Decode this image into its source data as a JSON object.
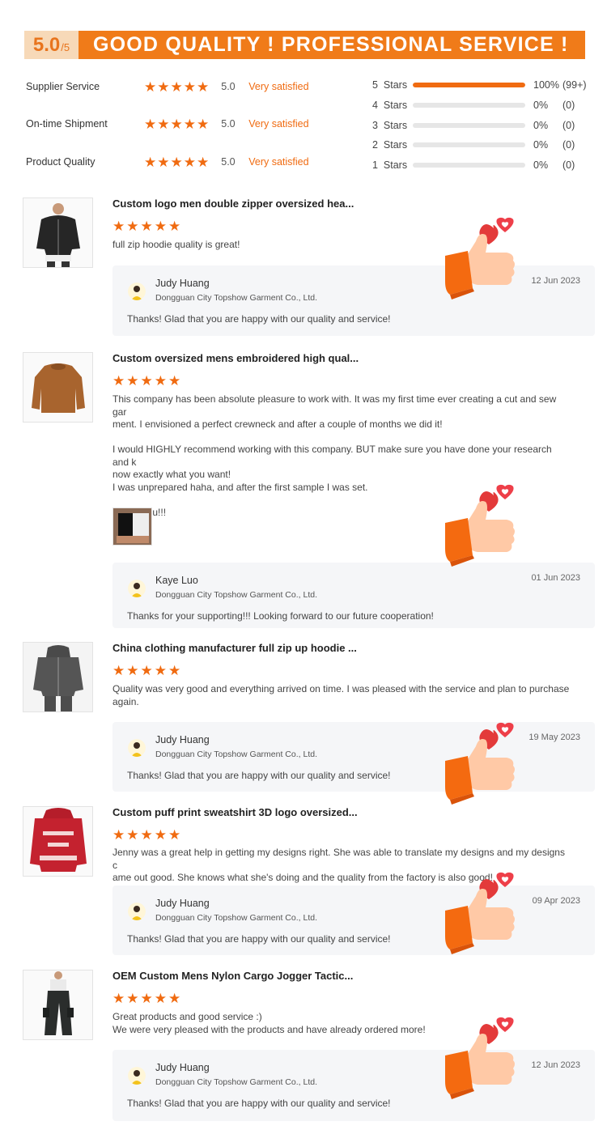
{
  "header": {
    "score": "5.0",
    "score_of": "/5",
    "slogan": "GOOD QUALITY ! PROFESSIONAL SERVICE !"
  },
  "ratings": [
    {
      "label": "Supplier Service",
      "stars": 5,
      "value": "5.0",
      "text": "Very satisfied"
    },
    {
      "label": "On-time Shipment",
      "stars": 5,
      "value": "5.0",
      "text": "Very satisfied"
    },
    {
      "label": "Product Quality",
      "stars": 5,
      "value": "5.0",
      "text": "Very satisfied"
    }
  ],
  "distribution": [
    {
      "label": "5  Stars",
      "fraction": 1.0,
      "pct": "100%",
      "count": "(99+)"
    },
    {
      "label": "4  Stars",
      "fraction": 0,
      "pct": "0%",
      "count": "(0)"
    },
    {
      "label": "3  Stars",
      "fraction": 0,
      "pct": "0%",
      "count": "(0)"
    },
    {
      "label": "2  Stars",
      "fraction": 0,
      "pct": "0%",
      "count": "(0)"
    },
    {
      "label": "1  Stars",
      "fraction": 0,
      "pct": "0%",
      "count": "(0)"
    }
  ],
  "reviews": [
    {
      "title": "Custom logo men double zipper oversized hea...",
      "stars": 5,
      "body": "full zip hoodie quality is great!",
      "reply": {
        "name": "Judy Huang",
        "company": "Dongguan City Topshow Garment Co., Ltd.",
        "date": "12 Jun 2023",
        "msg": "Thanks!  Glad that you are happy with our quality and service!"
      }
    },
    {
      "title": "Custom oversized mens embroidered high qual...",
      "stars": 5,
      "body": "This company has been absolute pleasure to work with. It was my first time ever creating a cut and sew gar\nment. I envisioned a perfect crewneck and after a couple of months we did it!\n\nI would HIGHLY recommend working with this company. BUT make sure you have done your research and k\nnow exactly what you want!\nI was unprepared haha, and after the first sample I was set.\n\nThank you!!!",
      "reply": {
        "name": "Kaye Luo",
        "company": "Dongguan City Topshow Garment Co., Ltd.",
        "date": "01 Jun 2023",
        "msg": "Thanks for your supporting!!! Looking forward to our future cooperation!"
      }
    },
    {
      "title": "China clothing manufacturer full zip up hoodie ...",
      "stars": 5,
      "body": "Quality was very good and everything arrived on time. I was pleased with the service and plan to purchase\nagain.",
      "reply": {
        "name": "Judy Huang",
        "company": "Dongguan City Topshow Garment Co., Ltd.",
        "date": "19 May 2023",
        "msg": "Thanks!  Glad that you are happy with our quality and service!"
      }
    },
    {
      "title": "Custom puff print sweatshirt 3D logo oversized...",
      "stars": 5,
      "body": "Jenny was a great help in getting my designs right. She was able to translate my designs and my designs c\name out good. She knows what she's doing and the quality from the factory is also good!",
      "reply": {
        "name": "Judy Huang",
        "company": "Dongguan City Topshow Garment Co., Ltd.",
        "date": "09 Apr 2023",
        "msg": "Thanks!  Glad that you are happy with our quality and service!"
      }
    },
    {
      "title": "OEM Custom Mens Nylon Cargo Jogger Tactic...",
      "stars": 5,
      "body": "Great products and good service :)\nWe were very pleased with the products and have already ordered more!",
      "reply": {
        "name": "Judy Huang",
        "company": "Dongguan City Topshow Garment Co., Ltd.",
        "date": "12 Jun 2023",
        "msg": "Thanks!  Glad that you are happy with our quality and service!"
      }
    }
  ],
  "colors": {
    "accent": "#f07b19",
    "star": "#f06b11",
    "bar_bg": "#e6e6e6",
    "reply_bg": "#f5f6f8"
  },
  "icons": {
    "star": "star-icon",
    "thumb": "thumbs-up-heart-icon",
    "avatar": "avatar-icon"
  }
}
